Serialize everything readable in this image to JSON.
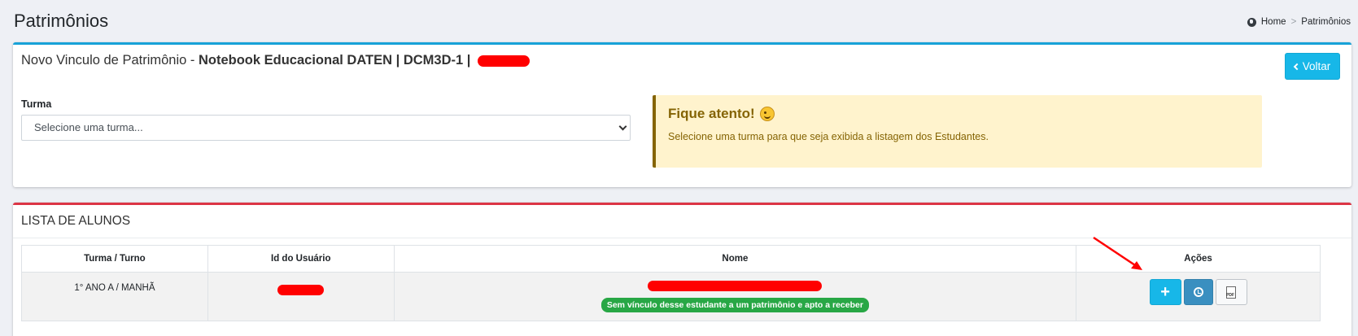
{
  "page": {
    "title": "Patrimônios",
    "breadcrumb": [
      "Home",
      "Patrimônios"
    ]
  },
  "link_card": {
    "title_prefix": "Novo Vinculo de Patrimônio -",
    "title_bold": "Notebook Educacional DATEN | DCM3D-1 |",
    "back_button": "Voltar",
    "turma_label": "Turma",
    "turma_select_value": "Selecione uma turma...",
    "alert": {
      "title": "Fique atento!",
      "text": "Selecione uma turma para que seja exibida a listagem dos Estudantes."
    }
  },
  "students": {
    "title": "LISTA DE ALUNOS",
    "columns": [
      "Turma / Turno",
      "Id do Usuário",
      "Nome",
      "Ações"
    ],
    "rows": [
      {
        "turma_turno": "1° ANO A / MANHÃ",
        "status_badge": "Sem vínculo desse estudante a um patrimônio e apto a receber"
      }
    ],
    "action_buttons": [
      "add-icon",
      "history-icon",
      "pdf-icon"
    ]
  },
  "colors": {
    "info": "#17b7e8",
    "danger": "#dc3545",
    "success": "#28a745",
    "warning_bg": "#fff3cd",
    "warning_text": "#856404",
    "redaction": "#ff0000"
  }
}
